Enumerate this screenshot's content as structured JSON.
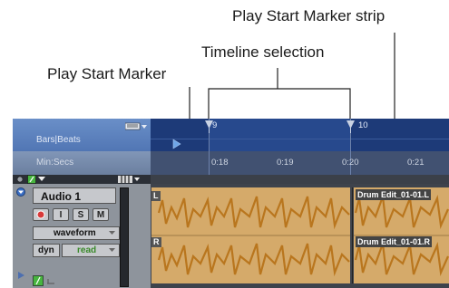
{
  "callouts": {
    "play_start_marker_strip": "Play Start Marker strip",
    "timeline_selection": "Timeline selection",
    "play_start_marker": "Play Start Marker"
  },
  "rulers": {
    "bars_beats_label": "Bars|Beats",
    "min_secs_label": "Min:Secs",
    "bar_ticks": [
      "9",
      "10"
    ],
    "min_secs_ticks": [
      "0:18",
      "0:19",
      "0:20",
      "0:21"
    ]
  },
  "track": {
    "name": "Audio 1",
    "record_button": "",
    "input_button": "I",
    "solo_button": "S",
    "mute_button": "M",
    "view_selector": "waveform",
    "playlist_button": "dyn",
    "automation_mode": "read"
  },
  "clips": {
    "left_channel_tag": "L",
    "right_channel_tag": "R",
    "drum_edit_left": "Drum Edit_01-01.L",
    "drum_edit_right": "Drum Edit_01-01.R"
  },
  "colors": {
    "selection_band": "#27498d",
    "ruler_blue": "#1d3a78",
    "waveform_fill": "#b9761e",
    "clip_background": "#d5aa6a"
  }
}
